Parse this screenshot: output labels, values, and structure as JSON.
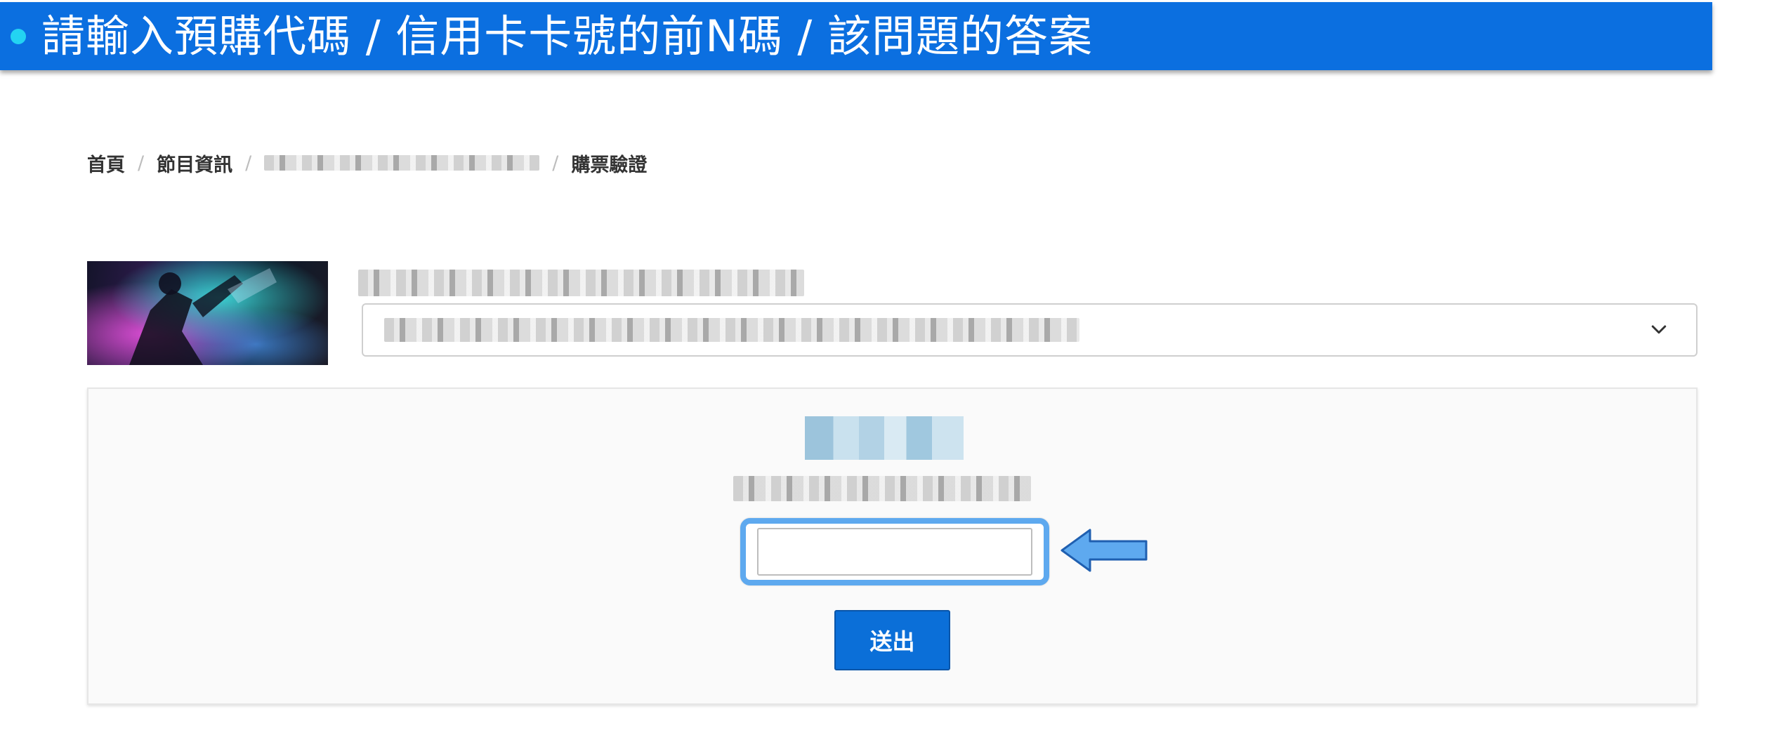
{
  "banner": {
    "text": "請輸入預購代碼 / 信用卡卡號的前N碼 / 該問題的答案"
  },
  "breadcrumb": {
    "items": [
      {
        "label": "首頁"
      },
      {
        "label": "節目資訊"
      },
      {
        "label": ""
      },
      {
        "label": "購票驗證"
      }
    ],
    "separator": "/"
  },
  "verification": {
    "code_input_value": "",
    "submit_label": "送出"
  },
  "colors": {
    "banner": "#0b6fe0",
    "accent": "#0b6fd8",
    "highlight": "#5ea9ef"
  },
  "icons": {
    "select_arrow": "chevron-down-icon",
    "pointer": "arrow-left-icon"
  }
}
